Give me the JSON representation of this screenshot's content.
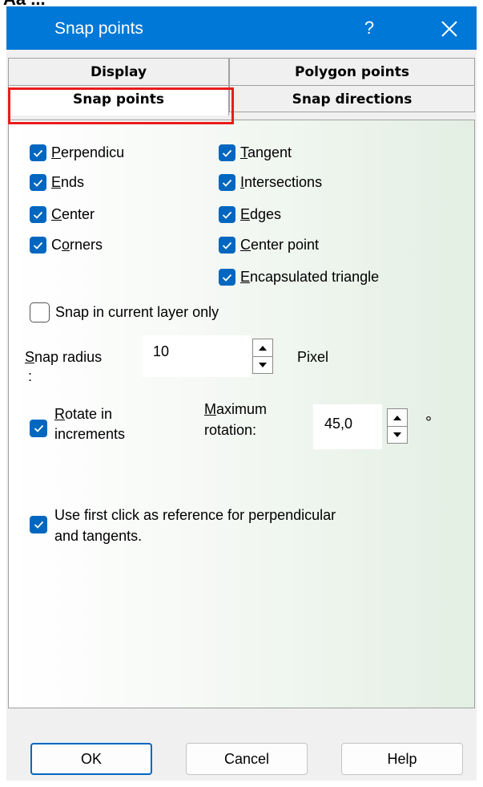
{
  "top_fragment": "Aa ...",
  "window": {
    "title": "Snap points",
    "help_glyph": "?"
  },
  "tabs": {
    "display": "Display",
    "polygon_points": "Polygon points",
    "snap_points": "Snap points",
    "snap_directions": "Snap directions"
  },
  "snap_options": {
    "perpendicular": {
      "first": "P",
      "rest": "erpendicu",
      "checked": true
    },
    "ends": {
      "first": "E",
      "rest": "nds",
      "checked": true
    },
    "center": {
      "first": "C",
      "rest": "enter",
      "checked": true
    },
    "corners": {
      "first": "C",
      "mid": "o",
      "rest": "rners",
      "checked": true
    },
    "tangent": {
      "first": "T",
      "rest": "angent",
      "checked": true
    },
    "intersections": {
      "first": "I",
      "rest": "ntersections",
      "checked": true
    },
    "edges": {
      "first": "E",
      "rest": "dges",
      "checked": true
    },
    "center_point": {
      "first": "C",
      "rest": "enter point",
      "checked": true
    },
    "encapsulated_triangle": {
      "first": "E",
      "rest": "ncapsulated triangle",
      "checked": true
    }
  },
  "current_layer_only": {
    "label": "Snap in current layer only",
    "checked": false
  },
  "snap_radius": {
    "first": "S",
    "rest": "nap radius",
    "colon": ":",
    "value": "10",
    "unit": "Pixel"
  },
  "rotate": {
    "checked": true,
    "first": "R",
    "line1_rest": "otate in",
    "line2": "increments",
    "max_first": "M",
    "max_line1_rest": "aximum",
    "max_line2": "rotation:",
    "value": "45,0",
    "unit": "°"
  },
  "reference": {
    "checked": true,
    "line1": "Use first click as reference for perpendicular",
    "line2": "and tangents."
  },
  "buttons": {
    "ok": "OK",
    "cancel": "Cancel",
    "help": "Help"
  },
  "colors": {
    "titlebar": "#0078d7",
    "checkbox": "#0067c0",
    "highlight": "#ea1c1c"
  }
}
